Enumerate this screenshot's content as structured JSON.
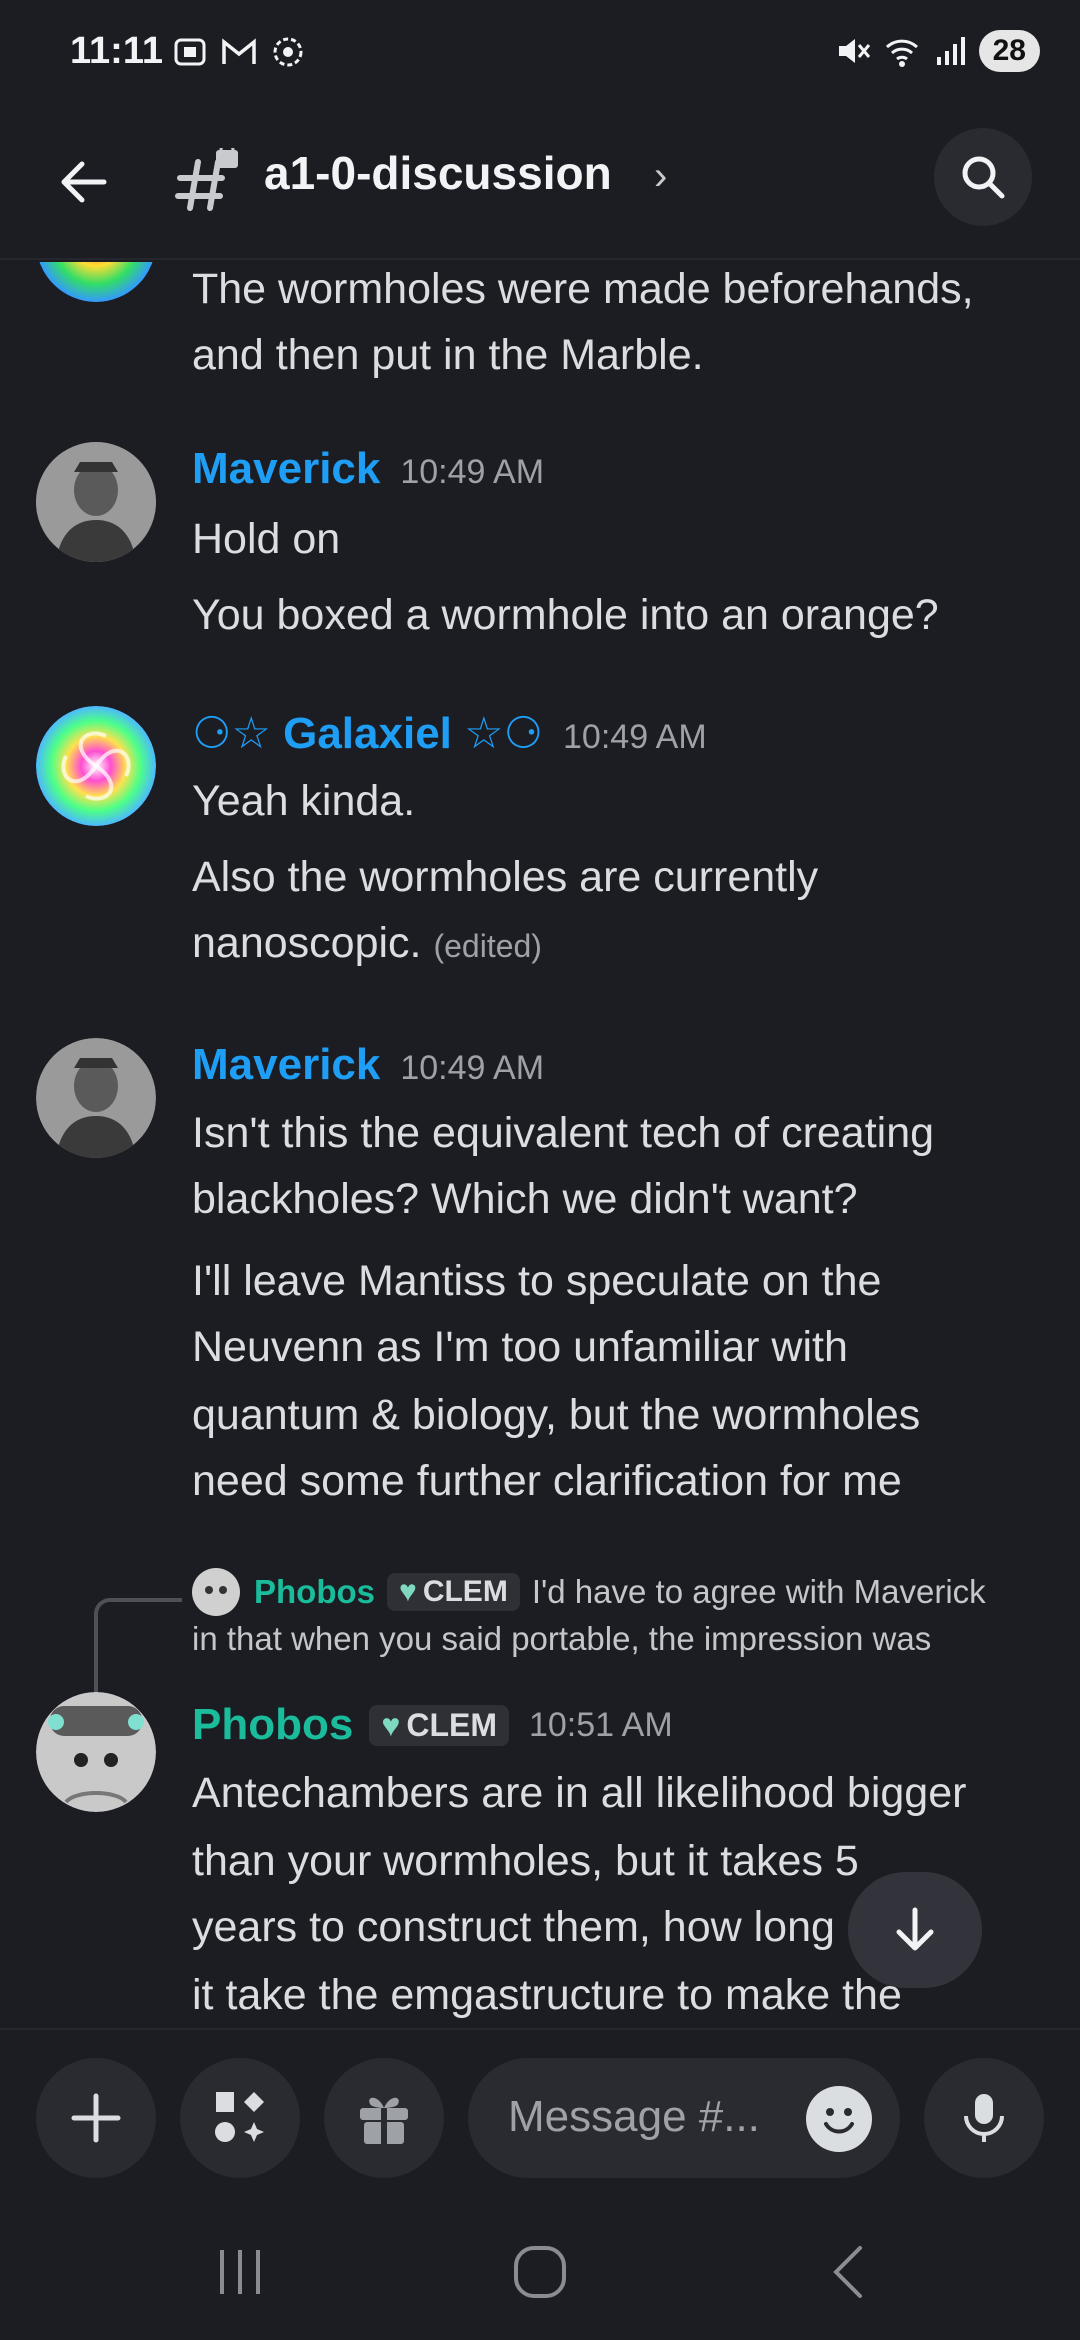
{
  "status": {
    "time": "11:11",
    "battery": "28"
  },
  "header": {
    "channel": "a1-0-discussion"
  },
  "messages": [
    {
      "lines": [
        "The wormholes were made beforehands,",
        "and then put in the Marble."
      ]
    },
    {
      "author": "Maverick",
      "time": "10:49 AM",
      "lines": [
        "Hold on",
        "You boxed a wormhole into an orange?"
      ]
    },
    {
      "author": "⚆☆ Galaxiel ☆⚆",
      "time": "10:49 AM",
      "lines": [
        "Yeah kinda.",
        "Also the wormholes are currently",
        "nanoscopic."
      ],
      "edited": "(edited)"
    },
    {
      "author": "Maverick",
      "time": "10:49 AM",
      "lines": [
        "Isn't this the equivalent tech of creating",
        "blackholes? Which we didn't want?",
        "I'll leave Mantiss to speculate on the",
        "Neuvenn as I'm too unfamiliar with",
        "quantum & biology, but the wormholes",
        "need some further clarification for me"
      ]
    },
    {
      "reply": {
        "author": "Phobos",
        "tag": "CLEM",
        "line1": "I'd have to agree with Maverick",
        "line2": "in that when you said portable, the impression was"
      },
      "author": "Phobos",
      "tag": "CLEM",
      "time": "10:51 AM",
      "lines": [
        "Antechambers are in all likelihood bigger",
        "than your wormholes, but it takes 5",
        "years to construct them, how long d",
        "it take the emgastructure to make the"
      ]
    }
  ],
  "composer": {
    "placeholder": "Message #..."
  },
  "colors": {
    "maverick": "#1e9ef5",
    "galaxiel": "#1e9ef5",
    "phobos": "#1abc9c"
  }
}
